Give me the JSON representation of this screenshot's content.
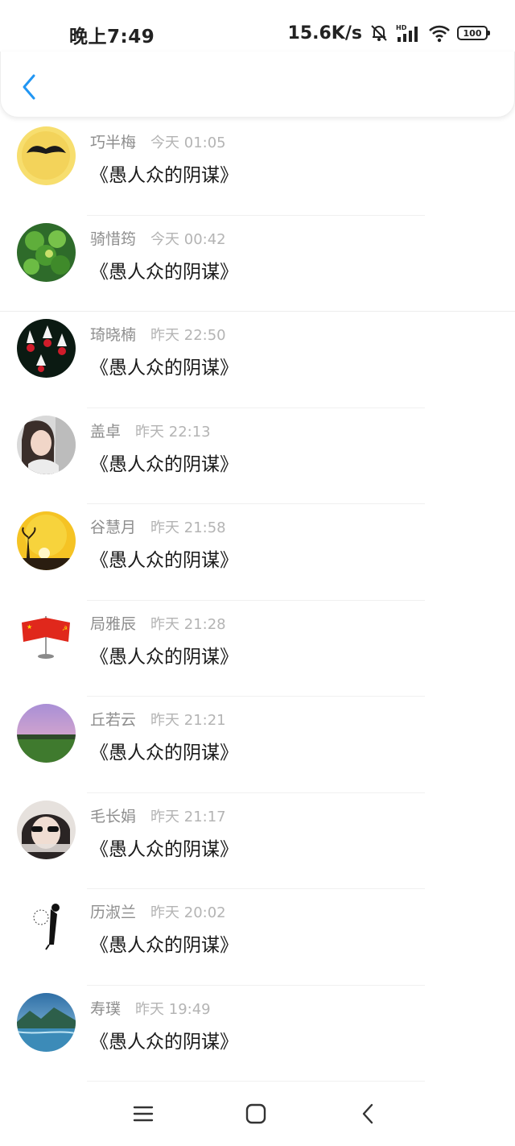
{
  "status_bar": {
    "time": "晚上7:49",
    "net_speed": "15.6K/s",
    "battery": "100",
    "icons": [
      "mute-bell-icon",
      "hd-signal-icon",
      "wifi-icon",
      "battery-icon"
    ]
  },
  "header": {
    "back_icon": "chevron-left-icon",
    "accent_color": "#2196F3"
  },
  "list": {
    "items": [
      {
        "name": "巧半梅",
        "time": "今天 01:05",
        "message": "《愚人众的阴谋》",
        "avatar": "mustache-yellow-avatar"
      },
      {
        "name": "骑惜筠",
        "time": "今天 00:42",
        "message": "《愚人众的阴谋》",
        "avatar": "clover-avatar"
      },
      {
        "name": "琦晓楠",
        "time": "昨天 22:50",
        "message": "《愚人众的阴谋》",
        "avatar": "fuchsia-flower-avatar"
      },
      {
        "name": "盖卓",
        "time": "昨天 22:13",
        "message": "《愚人众的阴谋》",
        "avatar": "girl-portrait-avatar"
      },
      {
        "name": "谷慧月",
        "time": "昨天 21:58",
        "message": "《愚人众的阴谋》",
        "avatar": "sunset-avatar"
      },
      {
        "name": "局雅辰",
        "time": "昨天 21:28",
        "message": "《愚人众的阴谋》",
        "avatar": "flags-avatar"
      },
      {
        "name": "丘若云",
        "time": "昨天 21:21",
        "message": "《愚人众的阴谋》",
        "avatar": "purple-sky-field-avatar"
      },
      {
        "name": "毛长娟",
        "time": "昨天 21:17",
        "message": "《愚人众的阴谋》",
        "avatar": "sunglasses-avatar"
      },
      {
        "name": "历淑兰",
        "time": "昨天 20:02",
        "message": "《愚人众的阴谋》",
        "avatar": "dandelion-figure-avatar"
      },
      {
        "name": "寿璞",
        "time": "昨天 19:49",
        "message": "《愚人众的阴谋》",
        "avatar": "lake-landscape-avatar"
      }
    ]
  },
  "nav_bar": {
    "icons": [
      "menu-icon",
      "home-square-icon",
      "back-triangle-icon"
    ]
  }
}
